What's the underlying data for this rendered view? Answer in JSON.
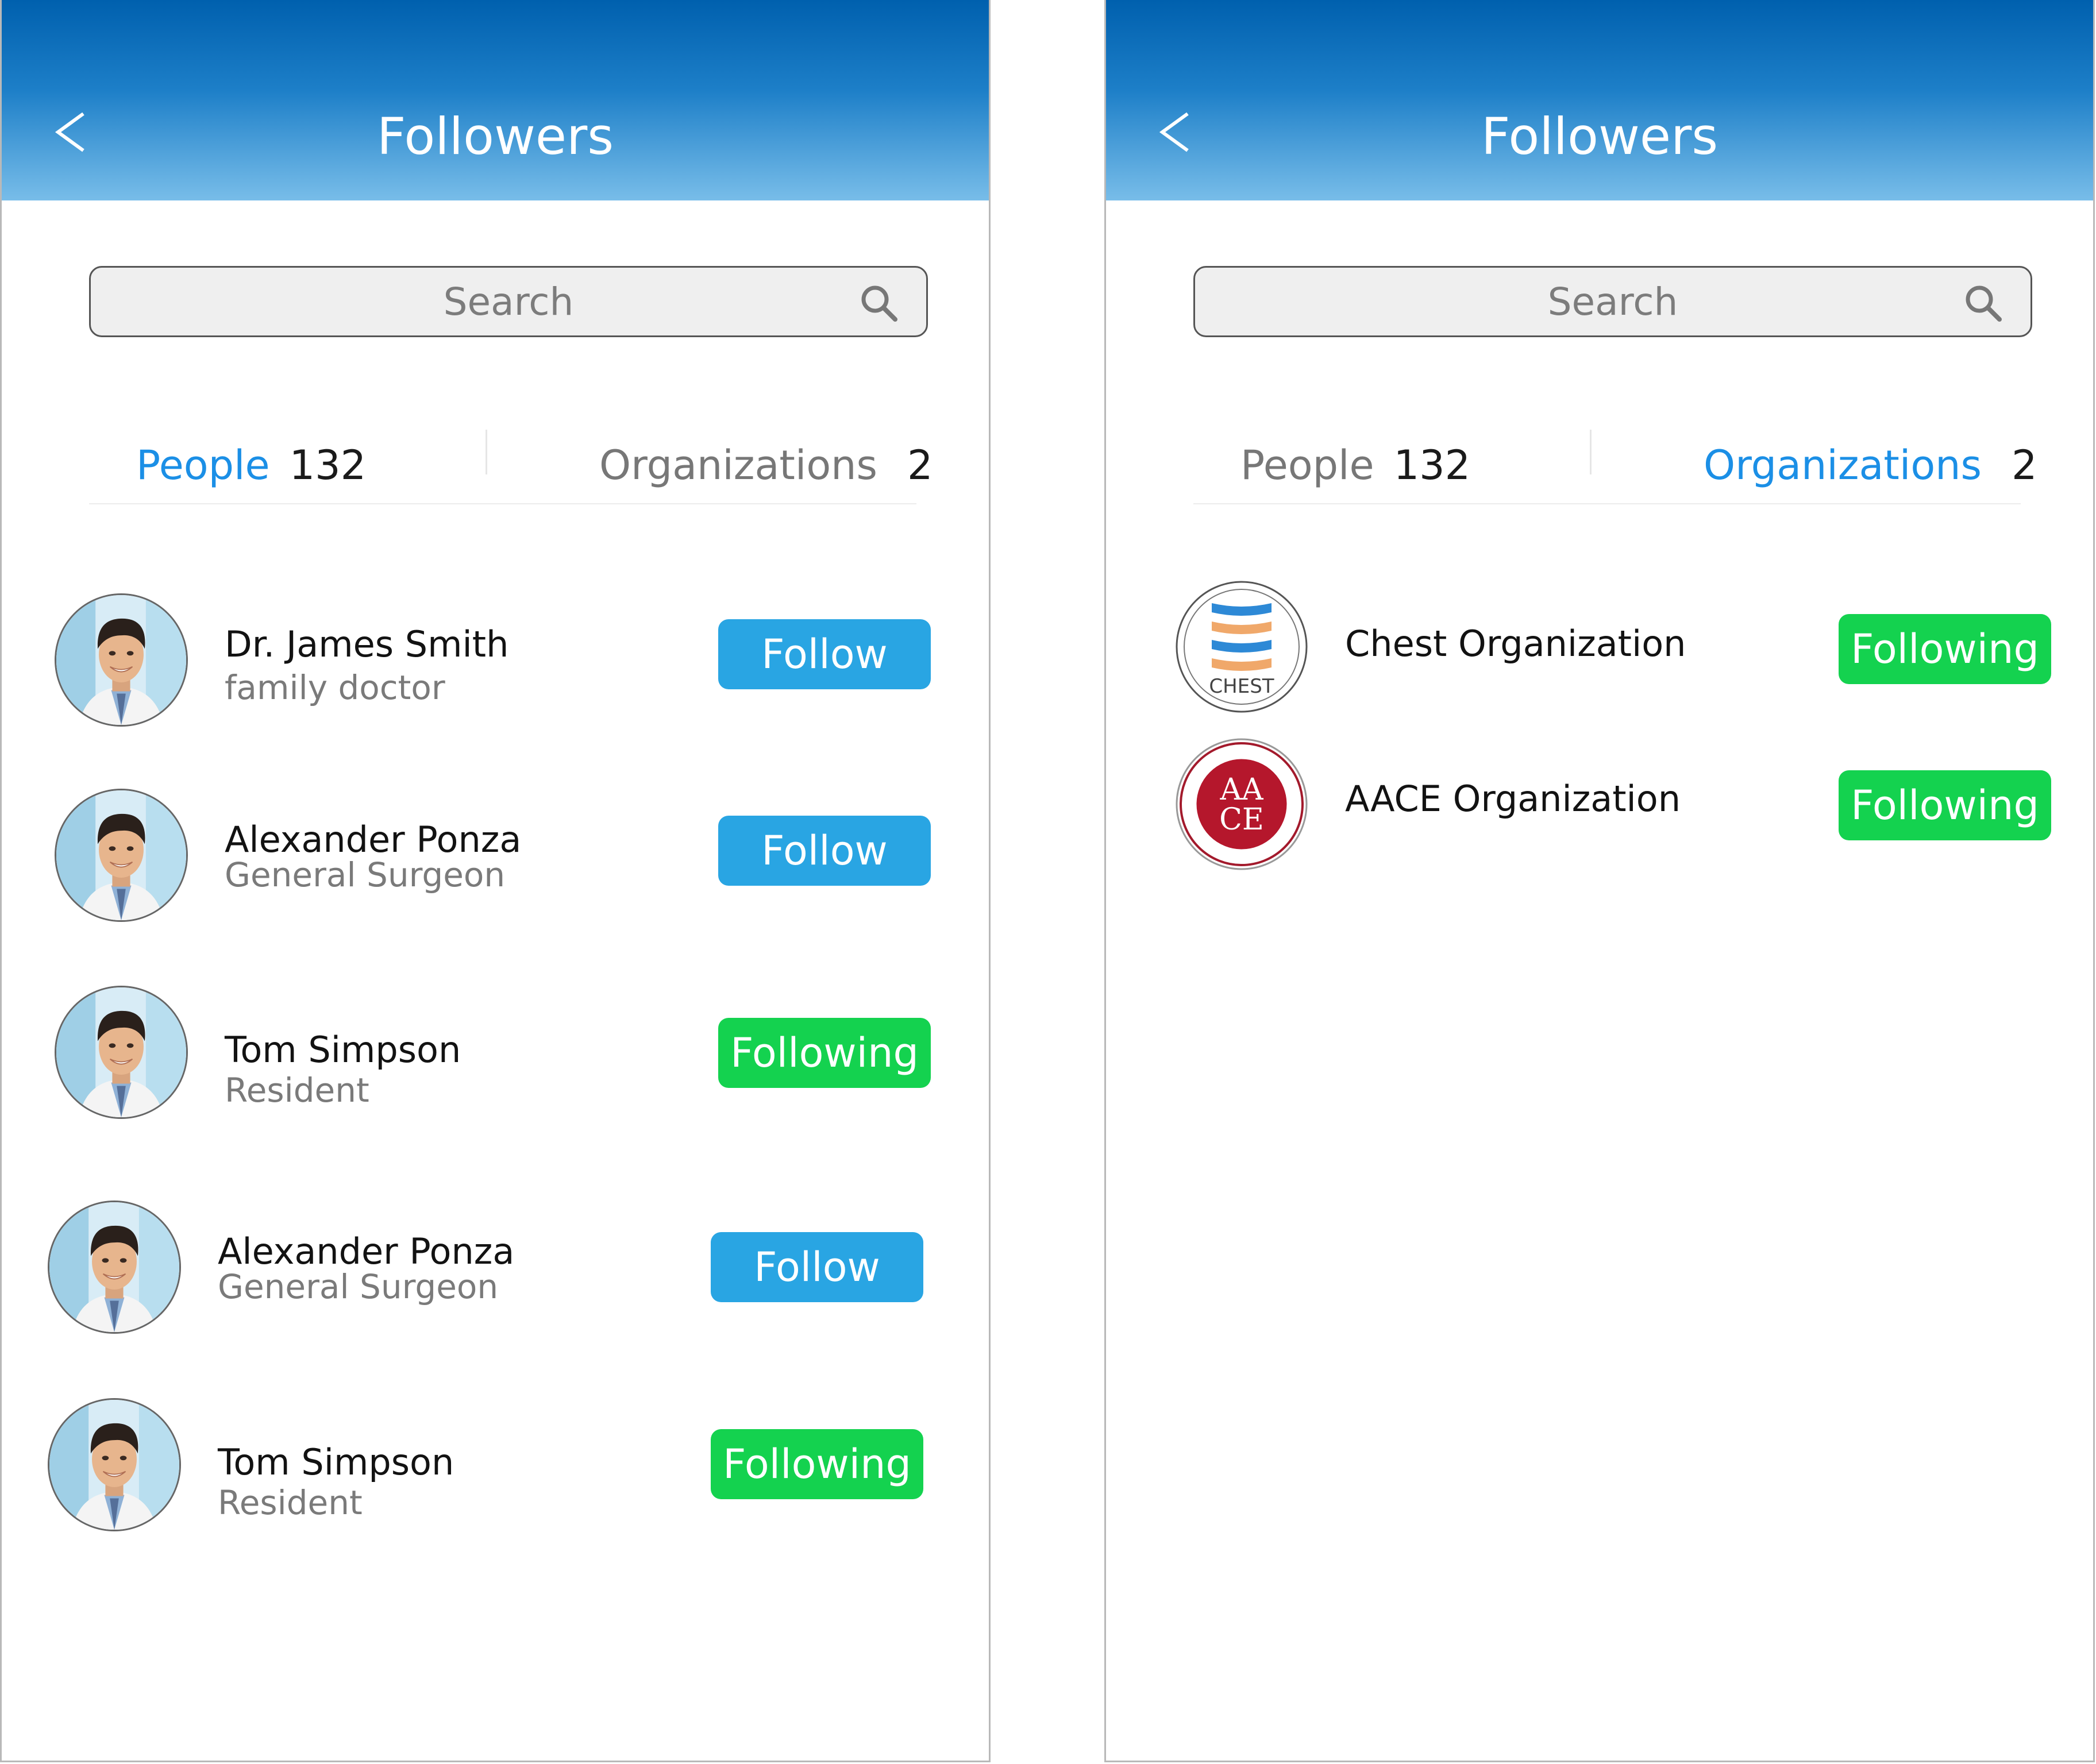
{
  "left_screen": {
    "title": "Followers",
    "search": {
      "placeholder": "Search"
    },
    "tabs": [
      {
        "label": "People",
        "count": "132",
        "active": true
      },
      {
        "label": "Organizations",
        "count": "2",
        "active": false
      }
    ],
    "people": [
      {
        "name": "Dr. James Smith",
        "role": "family doctor",
        "button": "Follow",
        "state": "follow"
      },
      {
        "name": "Alexander Ponza",
        "role": "General Surgeon",
        "button": "Follow",
        "state": "follow"
      },
      {
        "name": "Tom Simpson",
        "role": "Resident",
        "button": "Following",
        "state": "following"
      },
      {
        "name": "Alexander Ponza",
        "role": "General Surgeon",
        "button": "Follow",
        "state": "follow"
      },
      {
        "name": "Tom Simpson",
        "role": "Resident",
        "button": "Following",
        "state": "following"
      }
    ]
  },
  "right_screen": {
    "title": "Followers",
    "search": {
      "placeholder": "Search"
    },
    "tabs": [
      {
        "label": "People",
        "count": "132",
        "active": false
      },
      {
        "label": "Organizations",
        "count": "2",
        "active": true
      }
    ],
    "organizations": [
      {
        "name": "Chest Organization",
        "logo": "chest-logo",
        "logo_text": "CHEST",
        "button": "Following",
        "state": "following"
      },
      {
        "name": "AACE Organization",
        "logo": "aace-logo",
        "logo_text": "AACE",
        "button": "Following",
        "state": "following"
      }
    ]
  },
  "colors": {
    "header_top": "#0060ae",
    "header_bottom": "#78bde9",
    "active_tab": "#1b8fe6",
    "follow_button": "#29a5e3",
    "following_button": "#14d24f"
  }
}
